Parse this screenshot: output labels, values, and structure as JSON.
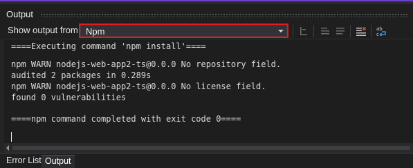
{
  "panel": {
    "title": "Output"
  },
  "toolbar": {
    "show_label": "Show output from:",
    "source_selected": "Npm",
    "buttons": [
      {
        "icon": "find-message-icon"
      },
      {
        "icon": "previous-message-icon"
      },
      {
        "icon": "next-message-icon"
      },
      {
        "icon": "clear-all-icon"
      },
      {
        "icon": "word-wrap-icon"
      }
    ]
  },
  "output": {
    "lines": [
      "====Executing command 'npm install'====",
      "",
      "npm WARN nodejs-web-app2-ts@0.0.0 No repository field.",
      "audited 2 packages in 0.289s",
      "npm WARN nodejs-web-app2-ts@0.0.0 No license field.",
      "found 0 vulnerabilities",
      "",
      "====npm command completed with exit code 0===="
    ]
  },
  "tabs": [
    {
      "label": "Error List",
      "active": false
    },
    {
      "label": "Output",
      "active": true
    }
  ],
  "colors": {
    "accent": "#6c3fd1",
    "highlight_border": "#e01b24",
    "background": "#1e1e1e"
  }
}
